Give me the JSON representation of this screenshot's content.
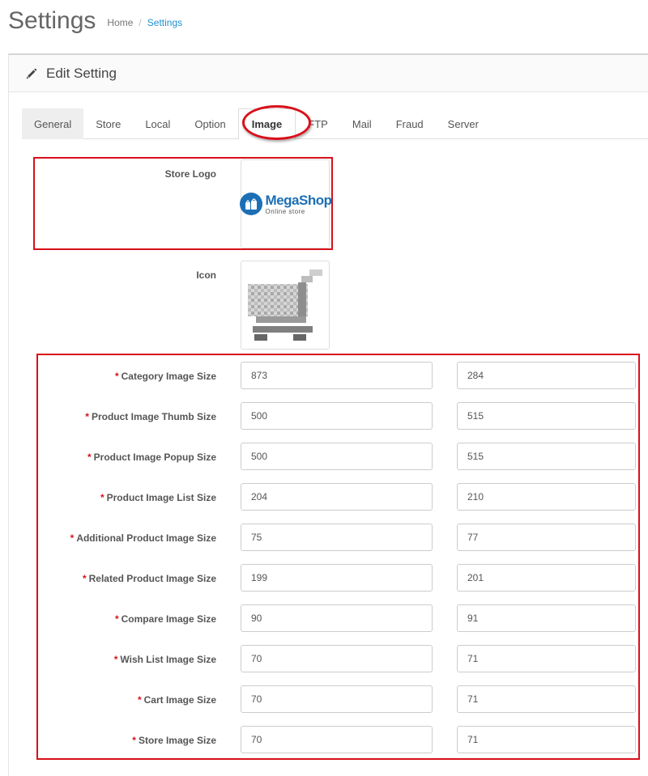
{
  "page": {
    "title": "Settings"
  },
  "breadcrumb": {
    "home": "Home",
    "separator": "/",
    "current": "Settings"
  },
  "panel": {
    "title": "Edit Setting",
    "icon": "pencil-icon"
  },
  "tabs": [
    {
      "label": "General"
    },
    {
      "label": "Store"
    },
    {
      "label": "Local"
    },
    {
      "label": "Option"
    },
    {
      "label": "Image"
    },
    {
      "label": "FTP"
    },
    {
      "label": "Mail"
    },
    {
      "label": "Fraud"
    },
    {
      "label": "Server"
    }
  ],
  "logo": {
    "label": "Store Logo",
    "brand": "MegaShop",
    "tagline": "Online store"
  },
  "icon_field": {
    "label": "Icon"
  },
  "required_mark": "*",
  "image_sizes": [
    {
      "label": "Category Image Size",
      "width": "873",
      "height": "284"
    },
    {
      "label": "Product Image Thumb Size",
      "width": "500",
      "height": "515"
    },
    {
      "label": "Product Image Popup Size",
      "width": "500",
      "height": "515"
    },
    {
      "label": "Product Image List Size",
      "width": "204",
      "height": "210"
    },
    {
      "label": "Additional Product Image Size",
      "width": "75",
      "height": "77"
    },
    {
      "label": "Related Product Image Size",
      "width": "199",
      "height": "201"
    },
    {
      "label": "Compare Image Size",
      "width": "90",
      "height": "91"
    },
    {
      "label": "Wish List Image Size",
      "width": "70",
      "height": "71"
    },
    {
      "label": "Cart Image Size",
      "width": "70",
      "height": "71"
    },
    {
      "label": "Store Image Size",
      "width": "70",
      "height": "71"
    }
  ],
  "colors": {
    "highlight": "#d9101a",
    "link": "#1e91cf",
    "logo_blue": "#1c6fb5"
  }
}
